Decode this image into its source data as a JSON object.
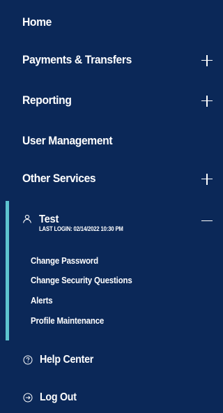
{
  "nav": {
    "items": [
      {
        "label": "Home",
        "expandable": false
      },
      {
        "label": "Payments & Transfers",
        "expandable": true
      },
      {
        "label": "Reporting",
        "expandable": true
      },
      {
        "label": "User Management",
        "expandable": false
      },
      {
        "label": "Other Services",
        "expandable": true
      }
    ]
  },
  "user": {
    "name": "Test",
    "last_login": "LAST LOGIN: 02/14/2022 10:30 PM",
    "expanded": true,
    "submenu": [
      {
        "label": "Change Password"
      },
      {
        "label": "Change Security Questions"
      },
      {
        "label": "Alerts"
      },
      {
        "label": "Profile Maintenance"
      }
    ]
  },
  "footer": {
    "help_label": "Help Center",
    "help_icon": "question-circle-icon",
    "logout_label": "Log Out",
    "logout_icon": "arrow-right-circle-icon"
  },
  "colors": {
    "background": "#0b2858",
    "accent": "#5dc4cf",
    "text": "#ffffff"
  }
}
